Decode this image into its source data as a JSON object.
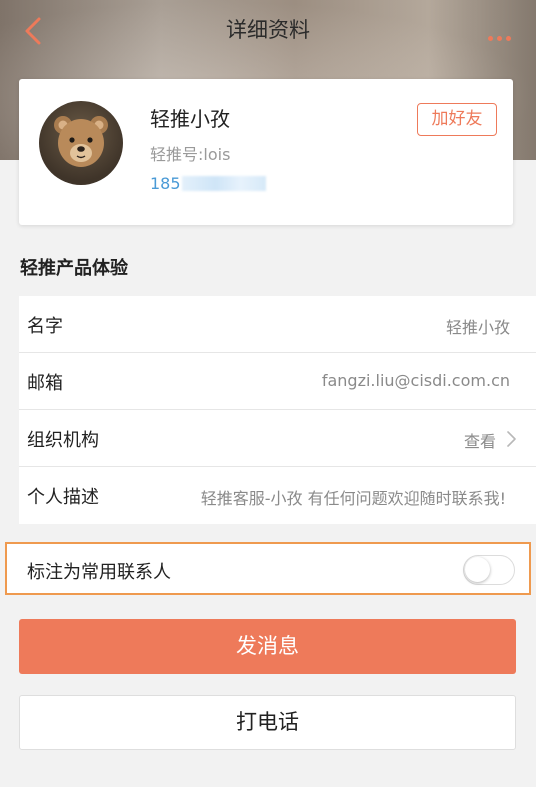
{
  "nav": {
    "title": "详细资料",
    "back_icon": "chevron-left-icon",
    "more_icon": "more-dots-icon"
  },
  "profile": {
    "name": "轻推小孜",
    "account_id": "轻推号:lois",
    "phone_visible": "185",
    "add_friend_label": "加好友",
    "avatar_icon": "teddy-bear-avatar"
  },
  "section": {
    "title": "轻推产品体验"
  },
  "details": [
    {
      "label": "名字",
      "value": "轻推小孜"
    },
    {
      "label": "邮箱",
      "value": "fangzi.liu@cisdi.com.cn"
    },
    {
      "label": "组织机构",
      "value": "查看"
    },
    {
      "label": "个人描述",
      "value": "轻推客服-小孜 有任何问题欢迎随时联系我!"
    }
  ],
  "favorite": {
    "label": "标注为常用联系人",
    "enabled": false
  },
  "actions": {
    "send_message": "发消息",
    "call": "打电话"
  },
  "colors": {
    "accent": "#ee7a5a",
    "link": "#4a9ad6",
    "highlight_border": "#ef9a4f"
  }
}
